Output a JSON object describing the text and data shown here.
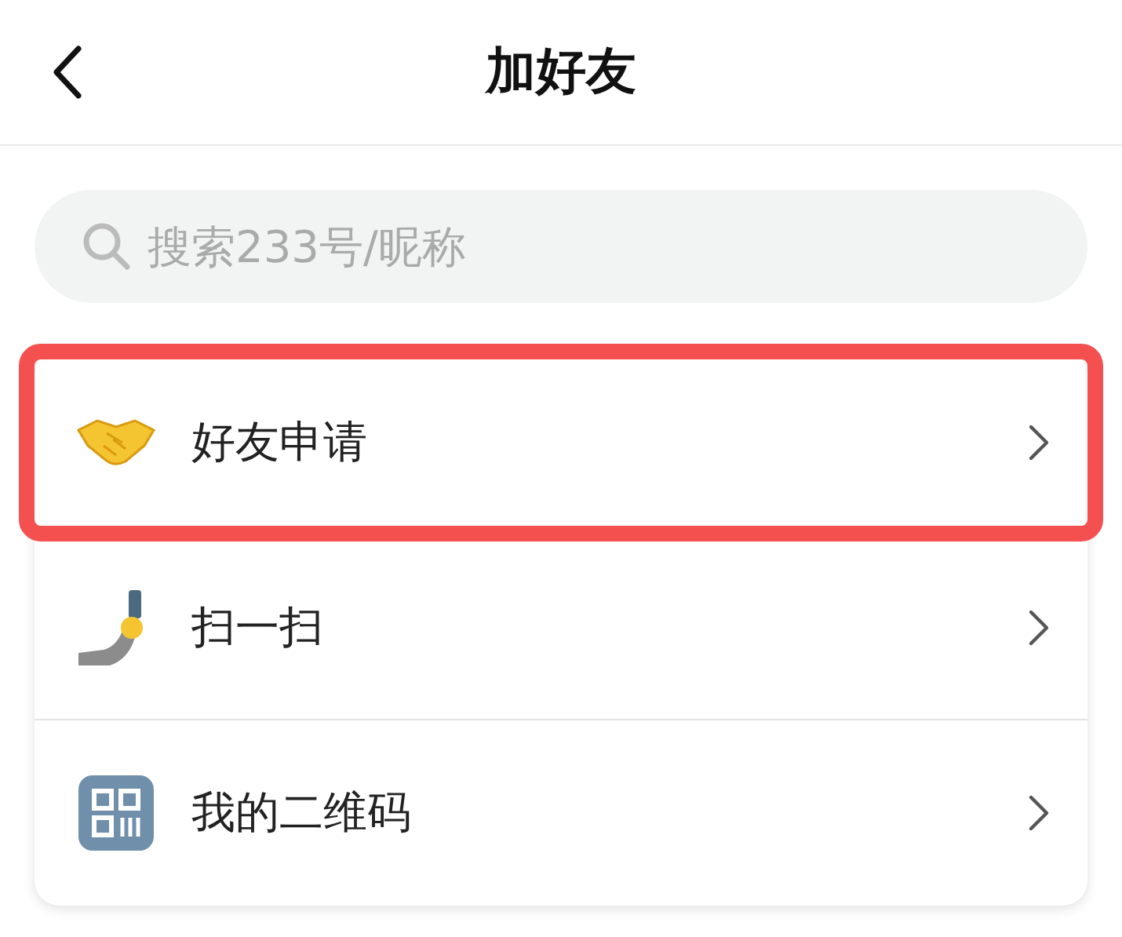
{
  "header": {
    "title": "加好友"
  },
  "search": {
    "placeholder": "搜索233号/昵称"
  },
  "items": [
    {
      "kind": "handshake",
      "label": "好友申请",
      "highlighted": true
    },
    {
      "kind": "scan",
      "label": "扫一扫",
      "highlighted": false
    },
    {
      "kind": "qr",
      "label": "我的二维码",
      "highlighted": false
    }
  ]
}
